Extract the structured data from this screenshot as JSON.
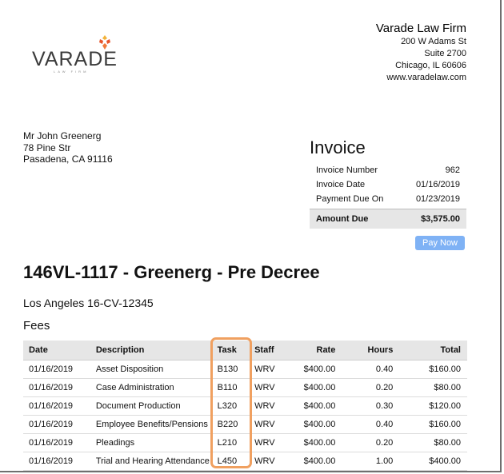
{
  "logo": {
    "text": "VARADE",
    "subtext": "LAW FIRM",
    "accent_color": "#e8542a"
  },
  "firm": {
    "name": "Varade Law Firm",
    "street": "200 W Adams St",
    "suite": "Suite 2700",
    "city": "Chicago, IL 60606",
    "website": "www.varadelaw.com"
  },
  "client": {
    "name": "Mr John Greenerg",
    "street": "78 Pine Str",
    "city": "Pasadena, CA 91116"
  },
  "invoice": {
    "title": "Invoice",
    "rows": [
      {
        "label": "Invoice Number",
        "value": "962"
      },
      {
        "label": "Invoice Date",
        "value": "01/16/2019"
      },
      {
        "label": "Payment Due On",
        "value": "01/23/2019"
      }
    ],
    "amount_due_label": "Amount Due",
    "amount_due_value": "$3,575.00",
    "pay_button_label": "Pay Now",
    "pay_button_color": "#7fb2f5"
  },
  "matter": {
    "title": "146VL-1117 - Greenerg - Pre Decree",
    "case": "Los Angeles 16-CV-12345",
    "section": "Fees"
  },
  "fees": {
    "headers": [
      "Date",
      "Description",
      "Task",
      "Staff",
      "Rate",
      "Hours",
      "Total"
    ],
    "rows": [
      [
        "01/16/2019",
        "Asset Disposition",
        "B130",
        "WRV",
        "$400.00",
        "0.40",
        "$160.00"
      ],
      [
        "01/16/2019",
        "Case Administration",
        "B110",
        "WRV",
        "$400.00",
        "0.20",
        "$80.00"
      ],
      [
        "01/16/2019",
        "Document Production",
        "L320",
        "WRV",
        "$400.00",
        "0.30",
        "$120.00"
      ],
      [
        "01/16/2019",
        "Employee Benefits/Pensions",
        "B220",
        "WRV",
        "$400.00",
        "0.40",
        "$160.00"
      ],
      [
        "01/16/2019",
        "Pleadings",
        "L210",
        "WRV",
        "$400.00",
        "0.20",
        "$80.00"
      ],
      [
        "01/16/2019",
        "Trial and Hearing Attendance",
        "L450",
        "WRV",
        "$400.00",
        "1.00",
        "$400.00"
      ]
    ],
    "highlight_color": "#f0a060"
  }
}
